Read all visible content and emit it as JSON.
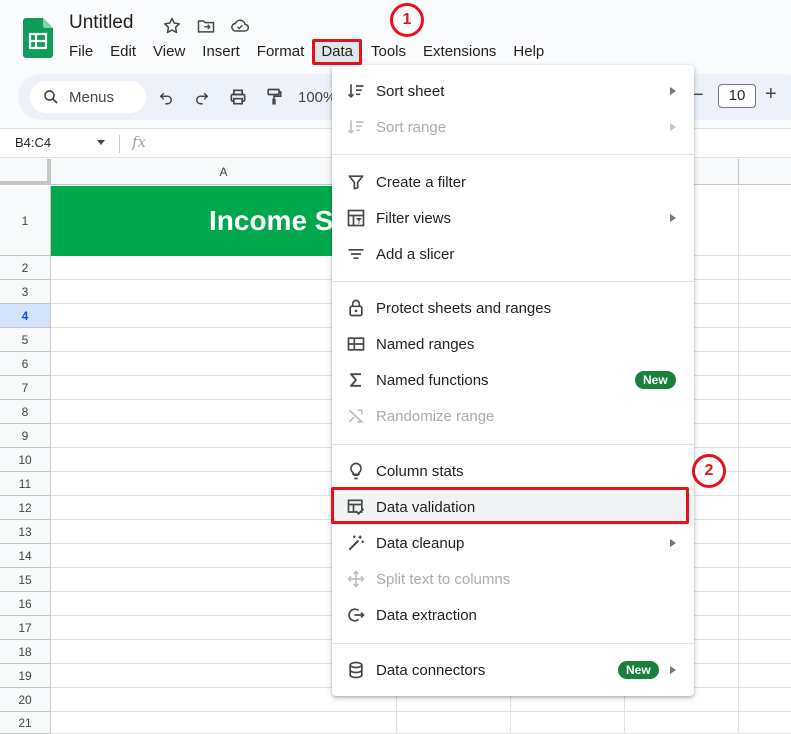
{
  "app": {
    "doc_title": "Untitled"
  },
  "menubar": [
    "File",
    "Edit",
    "View",
    "Insert",
    "Format",
    "Data",
    "Tools",
    "Extensions",
    "Help"
  ],
  "toolbar": {
    "search_label": "Menus",
    "zoom": "100%",
    "font_size": "10",
    "minus": "−",
    "plus": "+"
  },
  "formula_bar": {
    "namebox": "B4:C4",
    "fx": "fx"
  },
  "grid": {
    "column_header": "A",
    "rows": [
      "1",
      "2",
      "3",
      "4",
      "5",
      "6",
      "7",
      "8",
      "9",
      "10",
      "11",
      "12",
      "13",
      "14",
      "15",
      "16",
      "17",
      "18",
      "19",
      "20",
      "21"
    ],
    "selected_row": "4",
    "banner_text": "Income S"
  },
  "data_menu": {
    "items": [
      {
        "label": "Sort sheet",
        "icon": "sort-icon",
        "submenu": true
      },
      {
        "label": "Sort range",
        "icon": "sort-range-icon",
        "submenu": true,
        "disabled": true
      },
      {
        "label": "Create a filter",
        "icon": "filter-icon"
      },
      {
        "label": "Filter views",
        "icon": "filter-views-icon",
        "submenu": true
      },
      {
        "label": "Add a slicer",
        "icon": "slicer-icon"
      },
      {
        "label": "Protect sheets and ranges",
        "icon": "lock-icon"
      },
      {
        "label": "Named ranges",
        "icon": "named-ranges-icon"
      },
      {
        "label": "Named functions",
        "icon": "sigma-icon",
        "badge": "New"
      },
      {
        "label": "Randomize range",
        "icon": "shuffle-icon",
        "disabled": true
      },
      {
        "label": "Column stats",
        "icon": "lightbulb-icon"
      },
      {
        "label": "Data validation",
        "icon": "data-validation-icon",
        "highlighted": true
      },
      {
        "label": "Data cleanup",
        "icon": "magic-wand-icon",
        "submenu": true
      },
      {
        "label": "Split text to columns",
        "icon": "split-icon",
        "disabled": true
      },
      {
        "label": "Data extraction",
        "icon": "extraction-icon"
      },
      {
        "label": "Data connectors",
        "icon": "database-icon",
        "badge": "New",
        "submenu": true
      }
    ]
  },
  "callouts": {
    "one": "1",
    "two": "2"
  },
  "colors": {
    "accent_red": "#e8111a",
    "banner_green": "#00a84b",
    "badge_green": "#188038"
  }
}
